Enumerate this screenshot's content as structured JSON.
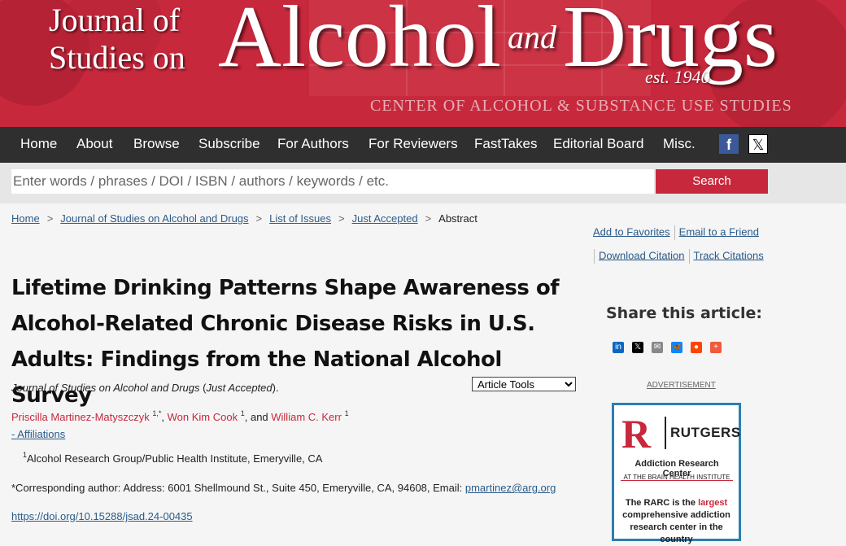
{
  "header": {
    "line1": "Journal of",
    "line2": "Studies on",
    "main": "Alcohol",
    "and": "and",
    "main2": "Drugs",
    "est": "est. 1940",
    "center": "CENTER OF ALCOHOL & SUBSTANCE USE STUDIES",
    "accent_color": "#c8283c"
  },
  "nav": {
    "items": [
      "Home",
      "About",
      "Browse",
      "Subscribe",
      "For Authors",
      "For Reviewers",
      "FastTakes",
      "Editorial Board",
      "Misc."
    ],
    "facebook": "f",
    "x": "𝕏"
  },
  "search": {
    "placeholder": "Enter words / phrases / DOI / ISBN / authors / keywords / etc.",
    "button": "Search"
  },
  "breadcrumb": [
    "Home",
    "Journal of Studies on Alcohol and Drugs",
    "List of Issues",
    "Just Accepted",
    "Abstract"
  ],
  "tools": {
    "favorites": "Add to Favorites",
    "email": "Email to a Friend",
    "download": "Download Citation",
    "track": "Track Citations",
    "select": "Article Tools"
  },
  "article": {
    "title": "Lifetime Drinking Patterns Shape Awareness of Alcohol-Related Chronic Disease Risks in U.S. Adults: Findings from the National Alcohol Survey",
    "journal": "Journal of Studies on Alcohol and Drugs",
    "status": "Just Accepted",
    "authors": [
      {
        "name": "Priscilla Martinez-Matyszczyk",
        "sup": "1,*"
      },
      {
        "name": "Won Kim Cook",
        "sup": "1"
      },
      {
        "name": "William C. Kerr",
        "sup": "1"
      }
    ],
    "affiliations_link": "- Affiliations",
    "affiliation_sup": "1",
    "affiliation": "Alcohol Research Group/Public Health Institute, Emeryville, CA",
    "corresponding": "*Corresponding author: Address: 6001 Shellmound St., Suite 450, Emeryville, CA, 94608, Email: ",
    "email": "pmartinez@arg.org",
    "doi": "https://doi.org/10.15288/jsad.24-00435"
  },
  "share": {
    "title": "Share this article:",
    "icons": [
      {
        "name": "linkedin-icon",
        "color": "#0a66c2",
        "glyph": "in"
      },
      {
        "name": "x-icon",
        "color": "#000000",
        "glyph": "𝕏"
      },
      {
        "name": "email-icon",
        "color": "#888888",
        "glyph": "✉"
      },
      {
        "name": "bluesky-icon",
        "color": "#1185fe",
        "glyph": "🦋"
      },
      {
        "name": "reddit-icon",
        "color": "#ff4500",
        "glyph": "●"
      },
      {
        "name": "addthis-icon",
        "color": "#f15a3a",
        "glyph": "+"
      }
    ]
  },
  "ad": {
    "label": "ADVERTISEMENT",
    "r": "R",
    "name": "RUTGERS",
    "center": "Addiction Research Center",
    "institute": "AT THE BRAIN HEALTH INSTITUTE",
    "body_a": "The RARC is the ",
    "body_hl": "largest",
    "body_b": " comprehensive addiction research center in the country"
  }
}
